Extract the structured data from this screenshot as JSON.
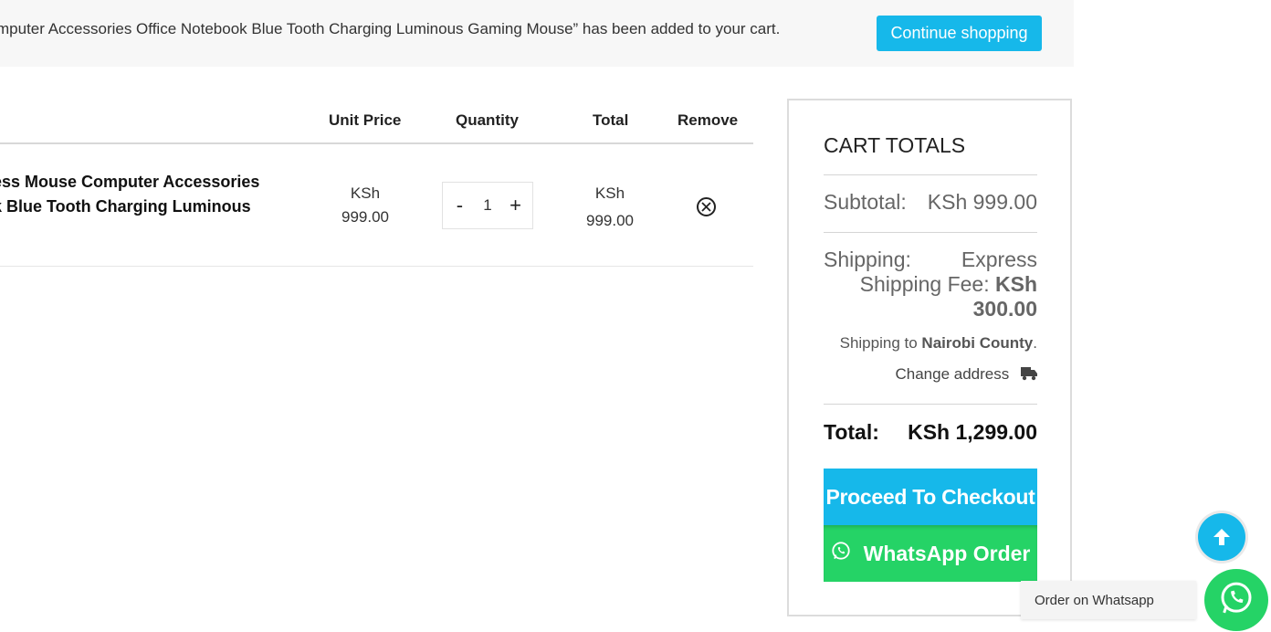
{
  "notice": {
    "text": "mputer Accessories Office Notebook Blue Tooth Charging Luminous Gaming Mouse” has been added to your cart.",
    "continue_label": "Continue shopping"
  },
  "cart_table": {
    "headers": {
      "unit_price": "Unit Price",
      "quantity": "Quantity",
      "total": "Total",
      "remove": "Remove"
    },
    "rows": [
      {
        "name_line1": "ess Mouse Computer Accessories",
        "name_line2": "k Blue Tooth Charging Luminous",
        "unit_price_currency": "KSh",
        "unit_price_amount": "999.00",
        "qty_minus": "-",
        "quantity": "1",
        "qty_plus": "+",
        "total_currency": "KSh",
        "total_amount": "999.00",
        "remove_icon": "close-circle-icon"
      }
    ]
  },
  "totals": {
    "title": "CART TOTALS",
    "subtotal_label": "Subtotal:",
    "subtotal_value": "KSh 999.00",
    "shipping_label": "Shipping:",
    "shipping_method": "Express",
    "shipping_fee_label": "Shipping Fee:",
    "shipping_fee_value_1": "KSh",
    "shipping_fee_value_2": "300.00",
    "shipping_to_prefix": "Shipping to",
    "shipping_to_place": "Nairobi County",
    "shipping_to_suffix": ".",
    "change_address_label": "Change address",
    "total_label": "Total:",
    "total_value": "KSh 1,299.00",
    "checkout_label": "Proceed To Checkout",
    "whatsapp_label": "WhatsApp Order"
  },
  "floating": {
    "whatsapp_label": "Order on Whatsapp"
  },
  "colors": {
    "accent": "#16b8ea",
    "whatsapp": "#25d366"
  }
}
